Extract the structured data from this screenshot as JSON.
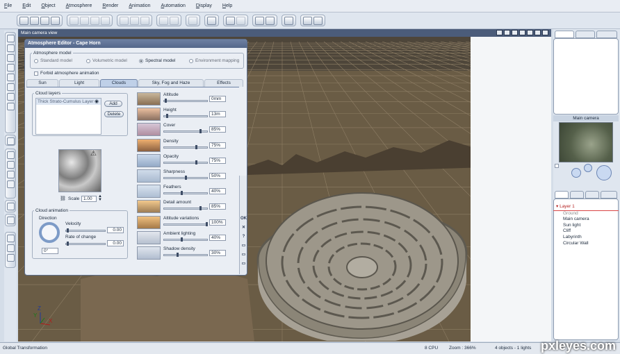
{
  "menu": [
    "File",
    "Edit",
    "Object",
    "Atmosphere",
    "Render",
    "Animation",
    "Automation",
    "Display",
    "Help"
  ],
  "viewport": {
    "title": "Main camera view"
  },
  "editor": {
    "title": "Atmosphere Editor - Cape Horn",
    "model_group": "Atmosphere model",
    "models": [
      "Standard model",
      "Volumetric model",
      "Spectral model",
      "Environment mapping"
    ],
    "selected_model": "Spectral model",
    "forbid_label": "Forbid atmosphere animation",
    "tabs": [
      "Sun",
      "Light",
      "Clouds",
      "Sky, Fog and Haze",
      "Effects"
    ],
    "active_tab": "Clouds",
    "cloud_layers_label": "Cloud layers",
    "layer_name": "Thick Strato-Cumulus Layer",
    "add_label": "Add",
    "delete_label": "Delete",
    "scale_label": "Scale",
    "scale_value": "1.00",
    "cloud_animation_label": "Cloud animation",
    "direction_label": "Direction",
    "velocity_label": "Velocity",
    "velocity_value": "0.00",
    "rate_label": "Rate of change",
    "rate_value": "0.00",
    "direction_value": "0°",
    "params": [
      {
        "label": "Altitude",
        "value": "0mm",
        "level": 0.02
      },
      {
        "label": "Height",
        "value": "13m",
        "level": 0.05
      },
      {
        "label": "Cover",
        "value": "85%",
        "level": 0.85
      },
      {
        "label": "Density",
        "value": "75%",
        "level": 0.75
      },
      {
        "label": "Opacity",
        "value": "75%",
        "level": 0.75
      },
      {
        "label": "Sharpness",
        "value": "50%",
        "level": 0.5
      },
      {
        "label": "Feathers",
        "value": "40%",
        "level": 0.4
      },
      {
        "label": "Detail amount",
        "value": "85%",
        "level": 0.85
      },
      {
        "label": "Altitude variations",
        "value": "100%",
        "level": 1.0
      },
      {
        "label": "Ambient lighting",
        "value": "40%",
        "level": 0.4
      },
      {
        "label": "Shadow density",
        "value": "30%",
        "level": 0.3
      }
    ],
    "side_ok": "OK",
    "side_x": "✕",
    "side_q": "?"
  },
  "right_panel": {
    "camera_label": "Main camera",
    "tree": [
      {
        "label": "Layer 1",
        "selected": true
      },
      {
        "label": "Ground",
        "muted": true
      },
      {
        "label": "Main camera"
      },
      {
        "label": "Sun light"
      },
      {
        "label": "Cliff"
      },
      {
        "label": "Labyrinth"
      },
      {
        "label": "Circular Wall"
      }
    ]
  },
  "status": {
    "left": "Global Transformation",
    "cpu": "8 CPU",
    "zoom": "Zoom : 366%",
    "objects": "4 objects - 1 lights"
  },
  "axes": {
    "z": "Z",
    "y": "Y",
    "x": "X"
  },
  "watermark": "pxleyes.com",
  "colors": {
    "accent": "#54678a",
    "selection": "#b31e1e"
  }
}
